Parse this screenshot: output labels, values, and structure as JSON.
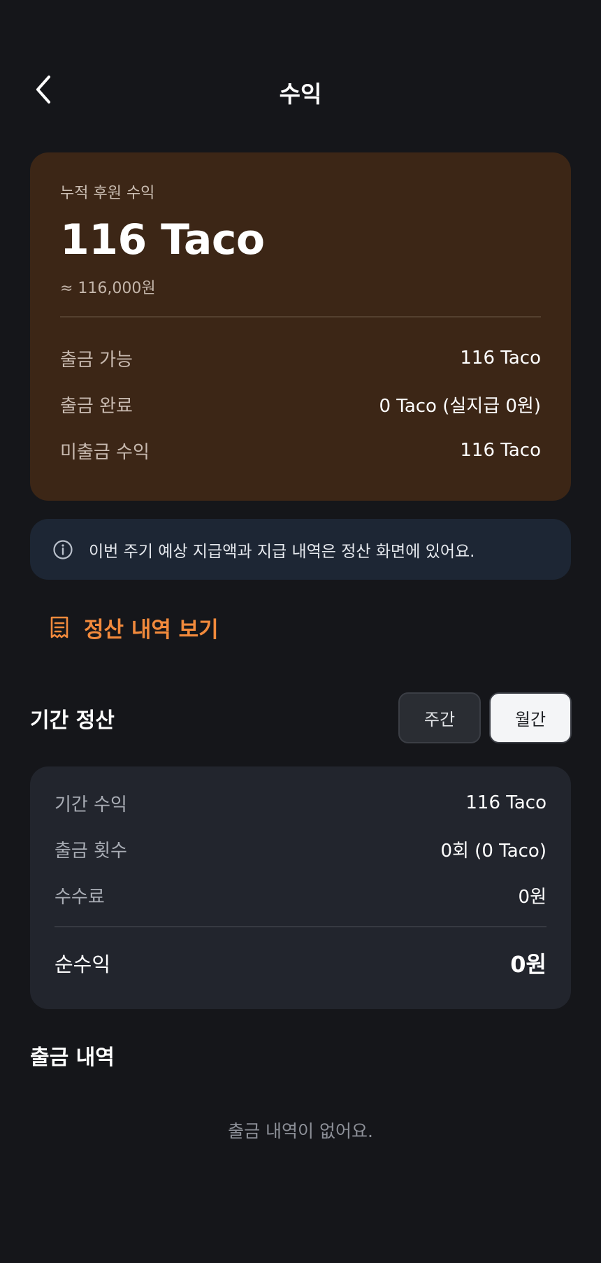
{
  "header": {
    "title": "수익",
    "back_icon": "chevron-left-icon"
  },
  "earnings": {
    "caption": "누적 후원 수익",
    "amount": "116 Taco",
    "krw": "≈ 116,000원",
    "rows": [
      {
        "label": "출금 가능",
        "value": "116 Taco"
      },
      {
        "label": "출금 완료",
        "value": "0 Taco (실지급 0원)"
      },
      {
        "label": "미출금 수익",
        "value": "116 Taco"
      }
    ]
  },
  "info": {
    "icon": "info-icon",
    "text": "이번 주기 예상 지급액과 지급 내역은 정산 화면에 있어요."
  },
  "settle_link": {
    "icon": "receipt-icon",
    "label": "정산 내역 보기"
  },
  "period": {
    "title": "기간 정산",
    "tabs": [
      {
        "label": "주간",
        "selected": false
      },
      {
        "label": "월간",
        "selected": true
      }
    ],
    "rows": [
      {
        "label": "기간 수익",
        "value": "116 Taco"
      },
      {
        "label": "출금 횟수",
        "value": "0회 (0 Taco)"
      },
      {
        "label": "수수료",
        "value": "0원"
      }
    ],
    "net": {
      "label": "순수익",
      "value": "0원"
    }
  },
  "withdrawals": {
    "title": "출금 내역",
    "empty": "출금 내역이 없어요."
  },
  "colors": {
    "accent": "#f28a3c",
    "card_bg": "#3c2616",
    "banner_bg": "#1d2634",
    "page_bg": "#15161a"
  }
}
